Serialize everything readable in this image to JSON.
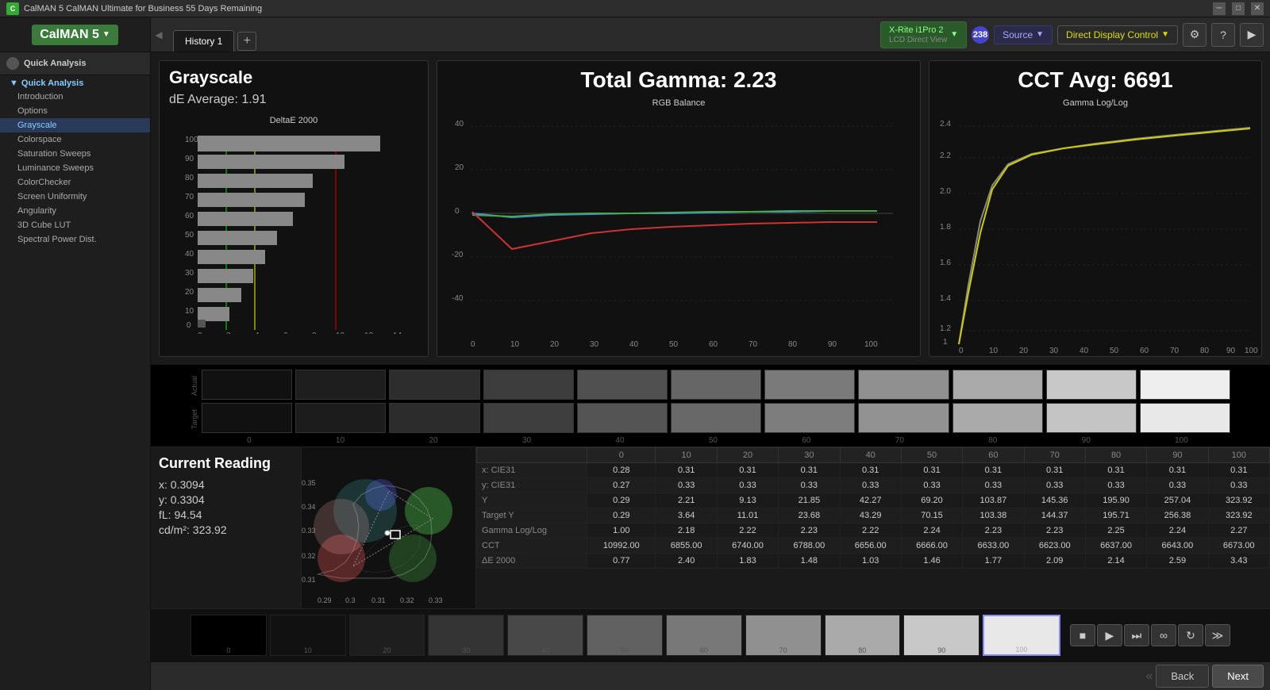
{
  "titlebar": {
    "title": "CalMAN 5 CalMAN Ultimate for Business 55 Days Remaining"
  },
  "topbar": {
    "logo": "CalMAN 5",
    "tab": "History 1",
    "meter": "X-Rite i1Pro 2\nLCD Direct View",
    "meter_badge": "238",
    "source": "Source",
    "ddc": "Direct Display Control"
  },
  "sidebar": {
    "section": "Quick Analysis",
    "group": "Quick Analysis",
    "items": [
      {
        "label": "Introduction",
        "active": false
      },
      {
        "label": "Options",
        "active": false
      },
      {
        "label": "Grayscale",
        "active": true
      },
      {
        "label": "Colorspace",
        "active": false
      },
      {
        "label": "Saturation Sweeps",
        "active": false
      },
      {
        "label": "Luminance Sweeps",
        "active": false
      },
      {
        "label": "ColorChecker",
        "active": false
      },
      {
        "label": "Screen Uniformity",
        "active": false
      },
      {
        "label": "Angularity",
        "active": false
      },
      {
        "label": "3D Cube LUT",
        "active": false
      },
      {
        "label": "Spectral Power Dist.",
        "active": false
      }
    ]
  },
  "grayscale": {
    "title": "Grayscale",
    "de_avg_label": "dE Average: 1.91",
    "chart1_title": "DeltaE 2000",
    "gamma_label": "Total Gamma: 2.23",
    "chart2_title": "RGB Balance",
    "cct_label": "CCT Avg: 6691",
    "chart3_title": "Gamma Log/Log"
  },
  "current_reading": {
    "title": "Current Reading",
    "x": "x: 0.3094",
    "y": "y: 0.3304",
    "fL": "fL: 94.54",
    "cdm2": "cd/m²: 323.92"
  },
  "table": {
    "headers": [
      "",
      "0",
      "10",
      "20",
      "30",
      "40",
      "50",
      "60",
      "70",
      "80",
      "90",
      "100"
    ],
    "rows": [
      {
        "label": "x: CIE31",
        "values": [
          "0.28",
          "0.31",
          "0.31",
          "0.31",
          "0.31",
          "0.31",
          "0.31",
          "0.31",
          "0.31",
          "0.31",
          "0.31"
        ]
      },
      {
        "label": "y: CIE31",
        "values": [
          "0.27",
          "0.33",
          "0.33",
          "0.33",
          "0.33",
          "0.33",
          "0.33",
          "0.33",
          "0.33",
          "0.33",
          "0.33"
        ]
      },
      {
        "label": "Y",
        "values": [
          "0.29",
          "2.21",
          "9.13",
          "21.85",
          "42.27",
          "69.20",
          "103.87",
          "145.36",
          "195.90",
          "257.04",
          "323.92"
        ]
      },
      {
        "label": "Target Y",
        "values": [
          "0.29",
          "3.64",
          "11.01",
          "23.68",
          "43.29",
          "70.15",
          "103.38",
          "144.37",
          "195.71",
          "256.38",
          "323.92"
        ]
      },
      {
        "label": "Gamma Log/Log",
        "values": [
          "1.00",
          "2.18",
          "2.22",
          "2.23",
          "2.22",
          "2.24",
          "2.23",
          "2.23",
          "2.25",
          "2.24",
          "2.27"
        ]
      },
      {
        "label": "CCT",
        "values": [
          "10992.00",
          "6855.00",
          "6740.00",
          "6788.00",
          "6656.00",
          "6666.00",
          "6633.00",
          "6623.00",
          "6637.00",
          "6643.00",
          "6673.00"
        ]
      },
      {
        "label": "ΔE 2000",
        "values": [
          "0.77",
          "2.40",
          "1.83",
          "1.48",
          "1.03",
          "1.46",
          "1.77",
          "2.09",
          "2.14",
          "2.59",
          "3.43"
        ]
      }
    ]
  },
  "swatches": {
    "labels": [
      "0",
      "10",
      "20",
      "30",
      "40",
      "50",
      "60",
      "70",
      "80",
      "90",
      "100"
    ],
    "actual_label": "Actual",
    "target_label": "Target"
  },
  "nav": {
    "back": "Back",
    "next": "Next"
  }
}
